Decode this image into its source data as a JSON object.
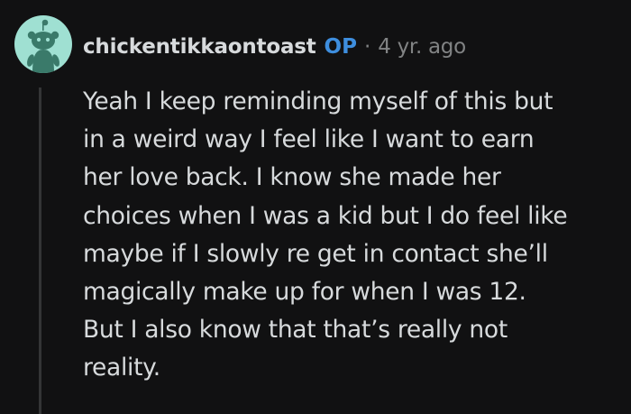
{
  "comment": {
    "author": "chickentikkaontoast",
    "badge": "OP",
    "separator": "·",
    "timestamp": "4 yr. ago",
    "body": "Yeah I keep reminding myself of this but\nin a weird way I feel like I want to earn\nher love back. I know she made her\nchoices when I was a kid but I do feel like\nmaybe if I slowly re get in contact she’ll\nmagically make up for when I was 12.\nBut I also know that that’s really not\nreality."
  },
  "avatar": {
    "icon": "snoo-avatar-icon",
    "background_color": "#9fe0d2"
  },
  "colors": {
    "background": "#111112",
    "text": "#d7dadc",
    "muted": "#818384",
    "op_badge": "#3e8ede",
    "thread_line": "#343536"
  }
}
